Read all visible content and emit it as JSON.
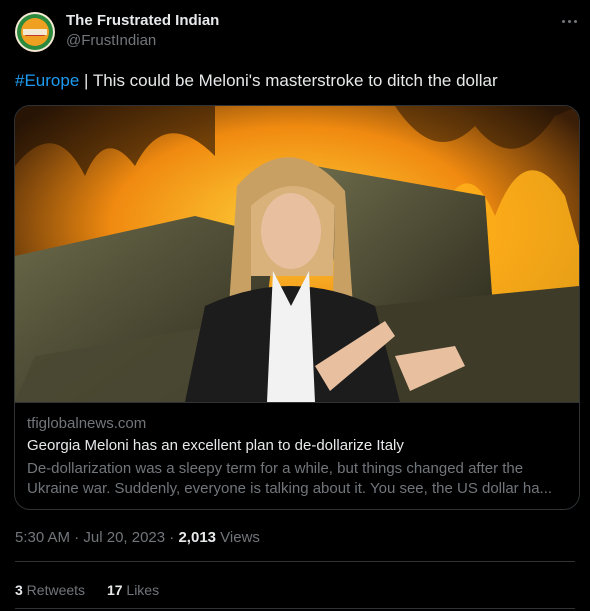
{
  "author": {
    "name": "The Frustrated Indian",
    "handle": "@FrustIndian",
    "avatar_logo_text": "FRUSTRATED"
  },
  "tweet": {
    "hashtag": "#Europe",
    "separator": " | ",
    "text": "This could be Meloni's masterstroke to ditch the dollar"
  },
  "card": {
    "domain": "tfiglobalnews.com",
    "title": "Georgia Meloni has an excellent plan to de-dollarize Italy",
    "description_line1": "De-dollarization was a sleepy term for a while, but things changed after the",
    "description_line2": "Ukraine war. Suddenly, everyone is talking about it. You see, the US dollar ha..."
  },
  "meta": {
    "time": "5:30 AM",
    "dot": " · ",
    "date": "Jul 20, 2023",
    "views_count": "2,013",
    "views_label": " Views"
  },
  "stats": {
    "retweets_count": "3",
    "retweets_label": " Retweets",
    "likes_count": "17",
    "likes_label": " Likes"
  },
  "colors": {
    "background": "#000000",
    "text": "#e7e9ea",
    "secondary": "#71767b",
    "link": "#1d9bf0",
    "border": "#2f3336"
  }
}
